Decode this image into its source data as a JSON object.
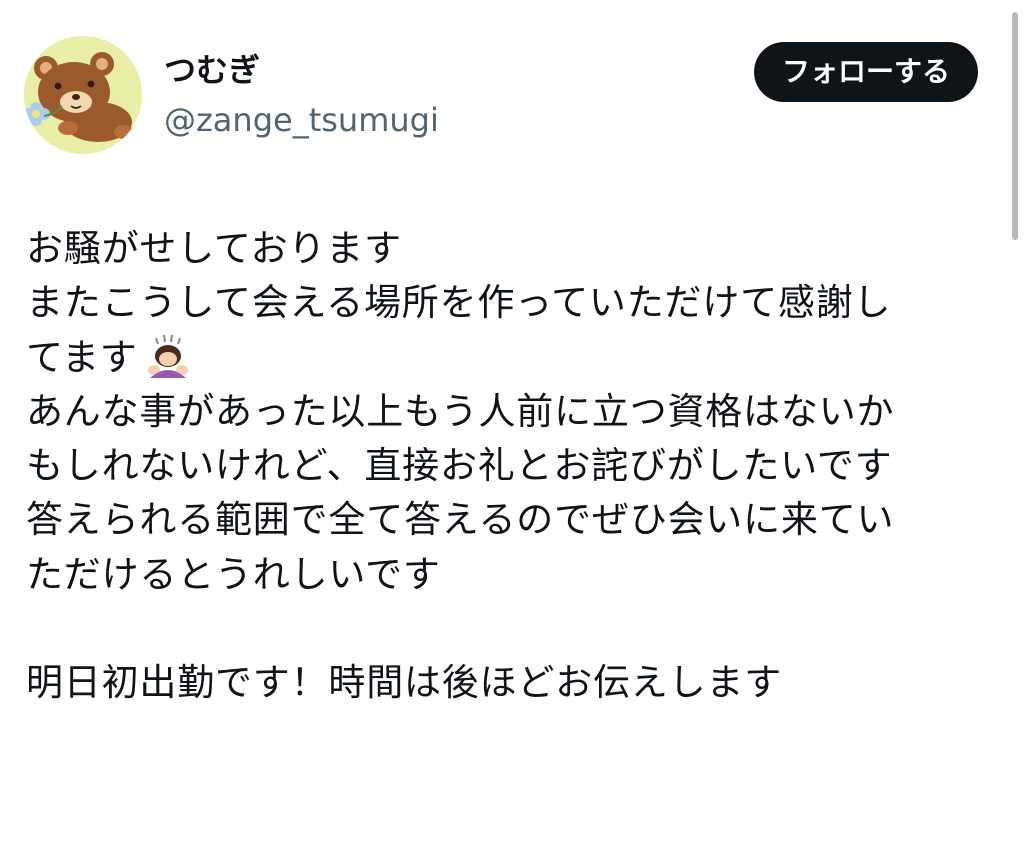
{
  "user": {
    "display_name": "つむぎ",
    "handle": "@zange_tsumugi",
    "avatar_icon": "bear-avatar-icon"
  },
  "actions": {
    "follow_label": "フォローする"
  },
  "tweet": {
    "lines": [
      "お騒がせしております",
      "またこうして会える場所を作っていただけて感謝し",
      "てます",
      "あんな事があった以上もう人前に立つ資格はないか",
      "もしれないけれど、直接お礼とお詫びがしたいです",
      "答えられる範囲で全て答えるのでぜひ会いに来てい",
      "ただけるとうれしいです",
      "明日初出勤です！時間は後ほどお伝えします"
    ],
    "emoji_icon": "person-bowing-emoji-icon"
  },
  "colors": {
    "avatar_bg": "#e9efa6",
    "follow_bg": "#0f1419",
    "handle_text": "#536471",
    "bear_brown": "#9b5a2e"
  }
}
